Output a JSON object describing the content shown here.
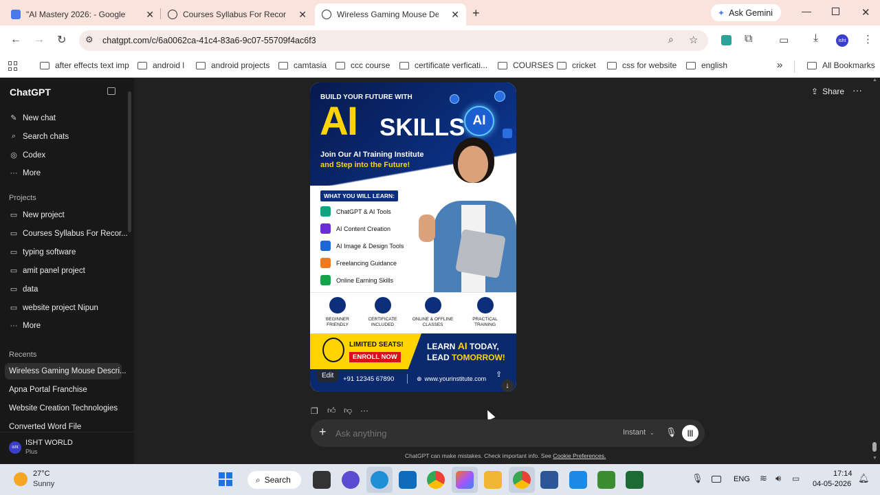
{
  "browser": {
    "tabs": [
      {
        "title": "\"AI Mastery 2026: - Google",
        "active": false
      },
      {
        "title": "Courses Syllabus For Recording",
        "active": false
      },
      {
        "title": "Wireless Gaming Mouse Descri",
        "active": true
      }
    ],
    "new_tab": "+",
    "ask_gemini": "Ask Gemini",
    "url": "chatgpt.com/c/6a0062ca-41c4-83a6-9c07-55709f4ac6f3",
    "profile_initials": "isht",
    "bookmarks": [
      "after effects text imp",
      "android l",
      "android projects",
      "camtasia",
      "ccc course",
      "certificate verficati...",
      "COURSES",
      "cricket",
      "css for website",
      "english"
    ],
    "all_bookmarks": "All Bookmarks",
    "more_bookmarks": "»"
  },
  "sidebar": {
    "title": "ChatGPT",
    "top_items": [
      "New chat",
      "Search chats",
      "Codex",
      "More"
    ],
    "projects_heading": "Projects",
    "projects": [
      "New project",
      "Courses Syllabus For Recor...",
      "typing software",
      "amit panel project",
      "data",
      "website project Nipun",
      "More"
    ],
    "recents_heading": "Recents",
    "recents": [
      "Wireless Gaming Mouse Descri...",
      "Apna Portal Franchise",
      "Website Creation Technologies",
      "Converted Word File"
    ],
    "user": {
      "name": "ISHT WORLD",
      "plan": "Plus",
      "avatar": "isht"
    }
  },
  "header": {
    "share": "Share",
    "more": "···"
  },
  "poster": {
    "top_line": "BUILD YOUR FUTURE WITH",
    "ai": "AI",
    "skills": "SKILLS",
    "ai_badge": "AI",
    "subtitle1": "Join Our AI Training Institute",
    "subtitle2": "and Step into the Future!",
    "learn_heading": "WHAT YOU WILL LEARN:",
    "learn_items": [
      "ChatGPT & AI Tools",
      "AI Content Creation",
      "AI Image & Design Tools",
      "Freelancing Guidance",
      "Online Earning Skills"
    ],
    "features": [
      {
        "l1": "BEGINNER",
        "l2": "FRIENDLY"
      },
      {
        "l1": "CERTIFICATE",
        "l2": "INCLUDED"
      },
      {
        "l1": "ONLINE & OFFLINE",
        "l2": "CLASSES"
      },
      {
        "l1": "PRACTICAL",
        "l2": "TRAINING"
      }
    ],
    "limited": "LIMITED SEATS!",
    "enroll": "ENROLL NOW",
    "learn_ai": "LEARN",
    "learn_ai_hl": "AI",
    "learn_ai_end": "TODAY,",
    "lead": "LEAD",
    "tomorrow": "TOMORROW!",
    "phone": "+91 12345 67890",
    "website": "www.yourinstitute.com",
    "edit": "Edit"
  },
  "composer": {
    "placeholder": "Ask anything",
    "mode": "Instant",
    "disclaimer": "ChatGPT can make mistakes. Check important info. See",
    "cookie_link": "Cookie Preferences."
  },
  "taskbar": {
    "weather_temp": "27°C",
    "weather_desc": "Sunny",
    "search": "Search",
    "lang": "ENG",
    "time": "17:14",
    "date": "04-05-2026"
  },
  "colors": {
    "accent_blue": "#0d2e7a",
    "yellow": "#ffd400",
    "red": "#d8101b",
    "chat_bg": "#212121",
    "sidebar_bg": "#181818"
  }
}
